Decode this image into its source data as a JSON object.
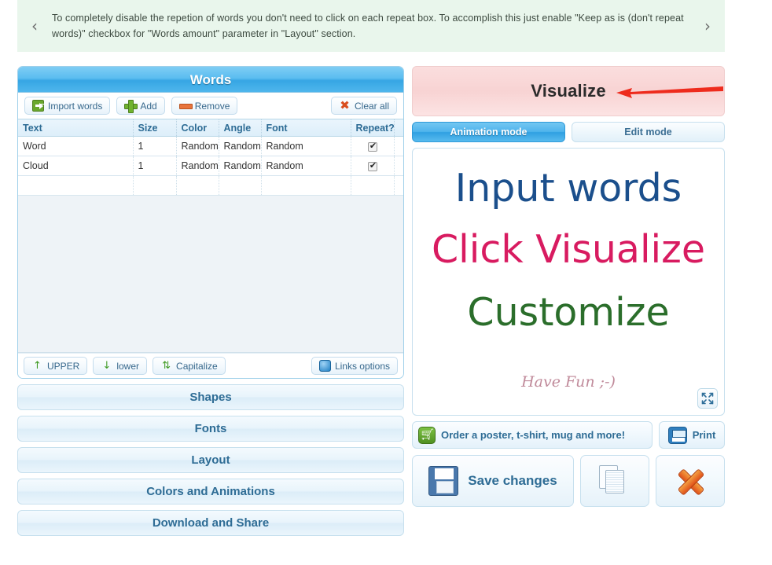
{
  "notice": {
    "prev_icon": "chevron-left-icon",
    "next_icon": "chevron-right-icon",
    "prev_glyph": "‹",
    "next_glyph": "›",
    "text": "To completely disable the repetion of words you don't need to click on each repeat box. To accomplish this just enable \"Keep as is (don't repeat words)\" checkbox for \"Words amount\" parameter in \"Layout\" section."
  },
  "words_panel": {
    "title": "Words",
    "toolbar": {
      "import": "Import words",
      "add": "Add",
      "remove": "Remove",
      "clear_all": "Clear all"
    },
    "table": {
      "columns": [
        "Text",
        "Size",
        "Color",
        "Angle",
        "Font",
        "Repeat?"
      ],
      "rows": [
        {
          "text": "Word",
          "size": "1",
          "color": "Random",
          "angle": "Random",
          "font": "Random",
          "repeat": true
        },
        {
          "text": "Cloud",
          "size": "1",
          "color": "Random",
          "angle": "Random",
          "font": "Random",
          "repeat": true
        },
        {
          "text": "",
          "size": "",
          "color": "",
          "angle": "",
          "font": "",
          "repeat": false
        }
      ]
    },
    "footer": {
      "upper": "UPPER",
      "lower": "lower",
      "capitalize": "Capitalize",
      "links_options": "Links options",
      "upper_glyph": "↑",
      "lower_glyph": "↓",
      "capitalize_glyph": "⇅"
    }
  },
  "accordion": [
    {
      "label": "Shapes"
    },
    {
      "label": "Fonts"
    },
    {
      "label": "Layout"
    },
    {
      "label": "Colors and Animations"
    },
    {
      "label": "Download and Share"
    }
  ],
  "visualize": {
    "label": "Visualize",
    "arrow_color": "#ee2b1d",
    "background": "#fad6d6"
  },
  "modes": {
    "animation": "Animation mode",
    "edit": "Edit mode",
    "active": "Animation mode"
  },
  "cloud": {
    "words": [
      {
        "text": "Input words",
        "color": "#1b4f8c"
      },
      {
        "text": "Click Visualize",
        "color": "#d81b60"
      },
      {
        "text": "Customize",
        "color": "#2b6e2b"
      },
      {
        "text": "Have Fun ;-)",
        "color": "#c08a9a"
      }
    ],
    "fullscreen_icon": "fullscreen-icon"
  },
  "bottom": {
    "order": "Order a poster, t-shirt, mug and more!",
    "print": "Print",
    "save": "Save changes",
    "copy_icon": "copy-documents-icon",
    "delete_icon": "delete-x-icon"
  }
}
